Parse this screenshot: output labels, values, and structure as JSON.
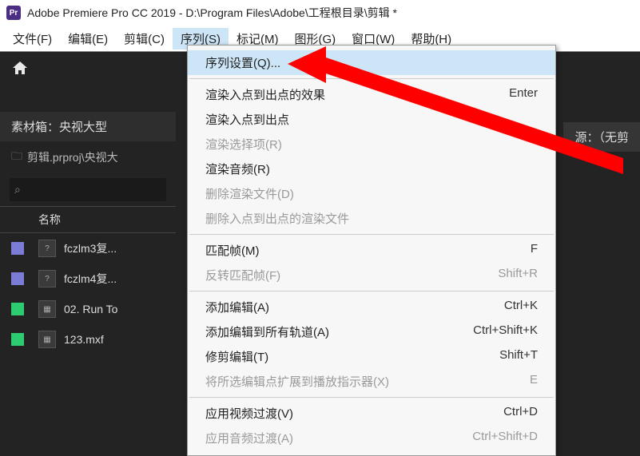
{
  "titlebar": {
    "logo": "Pr",
    "title": "Adobe Premiere Pro CC 2019 - D:\\Program Files\\Adobe\\工程根目录\\剪辑 *"
  },
  "menubar": {
    "items": [
      {
        "label": "文件(F)"
      },
      {
        "label": "编辑(E)"
      },
      {
        "label": "剪辑(C)"
      },
      {
        "label": "序列(S)",
        "selected": true
      },
      {
        "label": "标记(M)"
      },
      {
        "label": "图形(G)"
      },
      {
        "label": "窗口(W)"
      },
      {
        "label": "帮助(H)"
      }
    ]
  },
  "panel": {
    "bin_tab": "素材箱：央视大型",
    "breadcrumb": "剪辑.prproj\\央视大",
    "source_tab": "源：（无剪",
    "search_placeholder": "⌕"
  },
  "list": {
    "header": "名称",
    "rows": [
      {
        "swatch": "#7a7cd6",
        "icon": "?",
        "name": "fczlm3复..."
      },
      {
        "swatch": "#7a7cd6",
        "icon": "?",
        "name": "fczlm4复..."
      },
      {
        "swatch": "#2ecc71",
        "icon": "▦",
        "name": "02. Run To"
      },
      {
        "swatch": "#2ecc71",
        "icon": "▦",
        "name": "123.mxf"
      }
    ]
  },
  "dropdown": {
    "groups": [
      [
        {
          "label": "序列设置(Q)...",
          "highlight": true
        }
      ],
      [
        {
          "label": "渲染入点到出点的效果",
          "shortcut": "Enter"
        },
        {
          "label": "渲染入点到出点"
        },
        {
          "label": "渲染选择项(R)",
          "disabled": true
        },
        {
          "label": "渲染音频(R)"
        },
        {
          "label": "删除渲染文件(D)",
          "disabled": true
        },
        {
          "label": "删除入点到出点的渲染文件",
          "disabled": true
        }
      ],
      [
        {
          "label": "匹配帧(M)",
          "shortcut": "F"
        },
        {
          "label": "反转匹配帧(F)",
          "disabled": true,
          "shortcut": "Shift+R"
        }
      ],
      [
        {
          "label": "添加编辑(A)",
          "shortcut": "Ctrl+K"
        },
        {
          "label": "添加编辑到所有轨道(A)",
          "shortcut": "Ctrl+Shift+K"
        },
        {
          "label": "修剪编辑(T)",
          "shortcut": "Shift+T"
        },
        {
          "label": "将所选编辑点扩展到播放指示器(X)",
          "disabled": true,
          "shortcut": "E"
        }
      ],
      [
        {
          "label": "应用视频过渡(V)",
          "shortcut": "Ctrl+D"
        },
        {
          "label": "应用音频过渡(A)",
          "disabled": true,
          "shortcut": "Ctrl+Shift+D"
        }
      ]
    ]
  }
}
